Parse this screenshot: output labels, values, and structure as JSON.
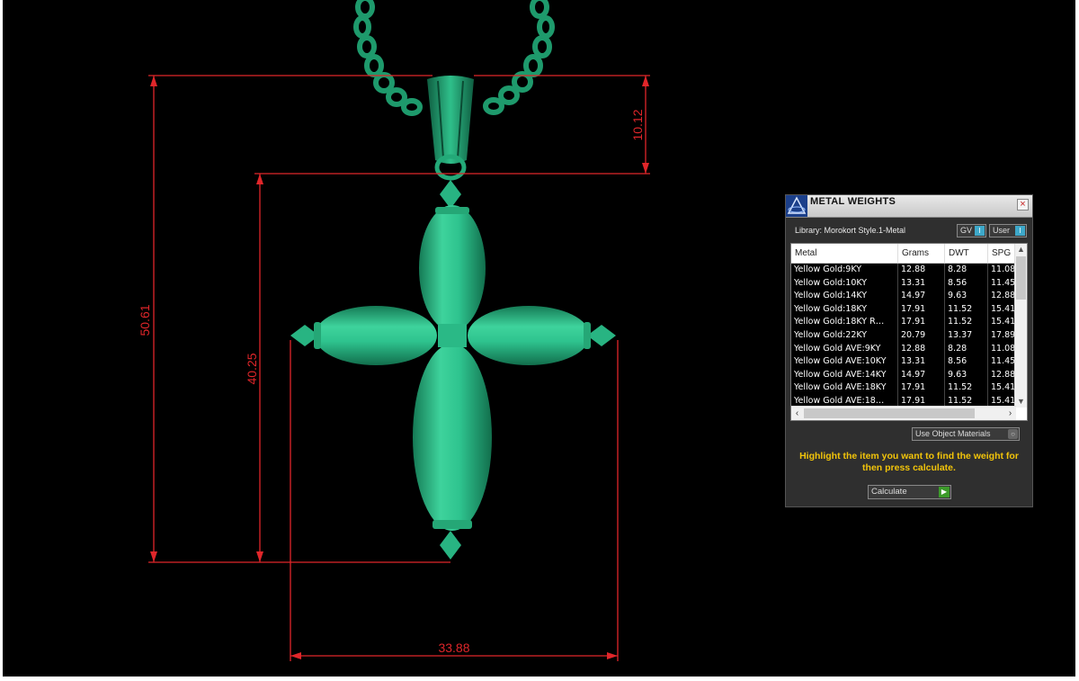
{
  "dimensions": {
    "overall_height": "50.61",
    "body_height": "40.25",
    "bail_height": "10.12",
    "width": "33.88"
  },
  "colors": {
    "model": "#2ec38e",
    "dimension_lines": "#e0262a",
    "panel_bg": "#2f2f2f",
    "hint_text": "#f2c40a"
  },
  "panel": {
    "title": "METAL WEIGHTS",
    "logo_icon": "app-logo-icon",
    "close_icon": "close-icon",
    "library_label": "Library: Morokort Style.1-Metal",
    "gv_button": "GV",
    "gv_tag": "I",
    "user_button": "User",
    "user_tag": "I",
    "columns": [
      "Metal",
      "Grams",
      "DWT",
      "SPG"
    ],
    "rows": [
      [
        "Yellow Gold:9KY",
        "12.88",
        "8.28",
        "11.08"
      ],
      [
        "Yellow Gold:10KY",
        "13.31",
        "8.56",
        "11.45"
      ],
      [
        "Yellow Gold:14KY",
        "14.97",
        "9.63",
        "12.88"
      ],
      [
        "Yellow Gold:18KY",
        "17.91",
        "11.52",
        "15.41"
      ],
      [
        "Yellow Gold:18KY R…",
        "17.91",
        "11.52",
        "15.41"
      ],
      [
        "Yellow Gold:22KY",
        "20.79",
        "13.37",
        "17.89"
      ],
      [
        "Yellow Gold AVE:9KY",
        "12.88",
        "8.28",
        "11.08"
      ],
      [
        "Yellow Gold AVE:10KY",
        "13.31",
        "8.56",
        "11.45"
      ],
      [
        "Yellow Gold AVE:14KY",
        "14.97",
        "9.63",
        "12.88"
      ],
      [
        "Yellow Gold AVE:18KY",
        "17.91",
        "11.52",
        "15.41"
      ],
      [
        "Yellow Gold AVE:18…",
        "17.91",
        "11.52",
        "15.41"
      ]
    ],
    "use_object_materials": "Use Object Materials",
    "hint": "Highlight the item you want to find the weight for then press calculate.",
    "calculate_button": "Calculate"
  }
}
